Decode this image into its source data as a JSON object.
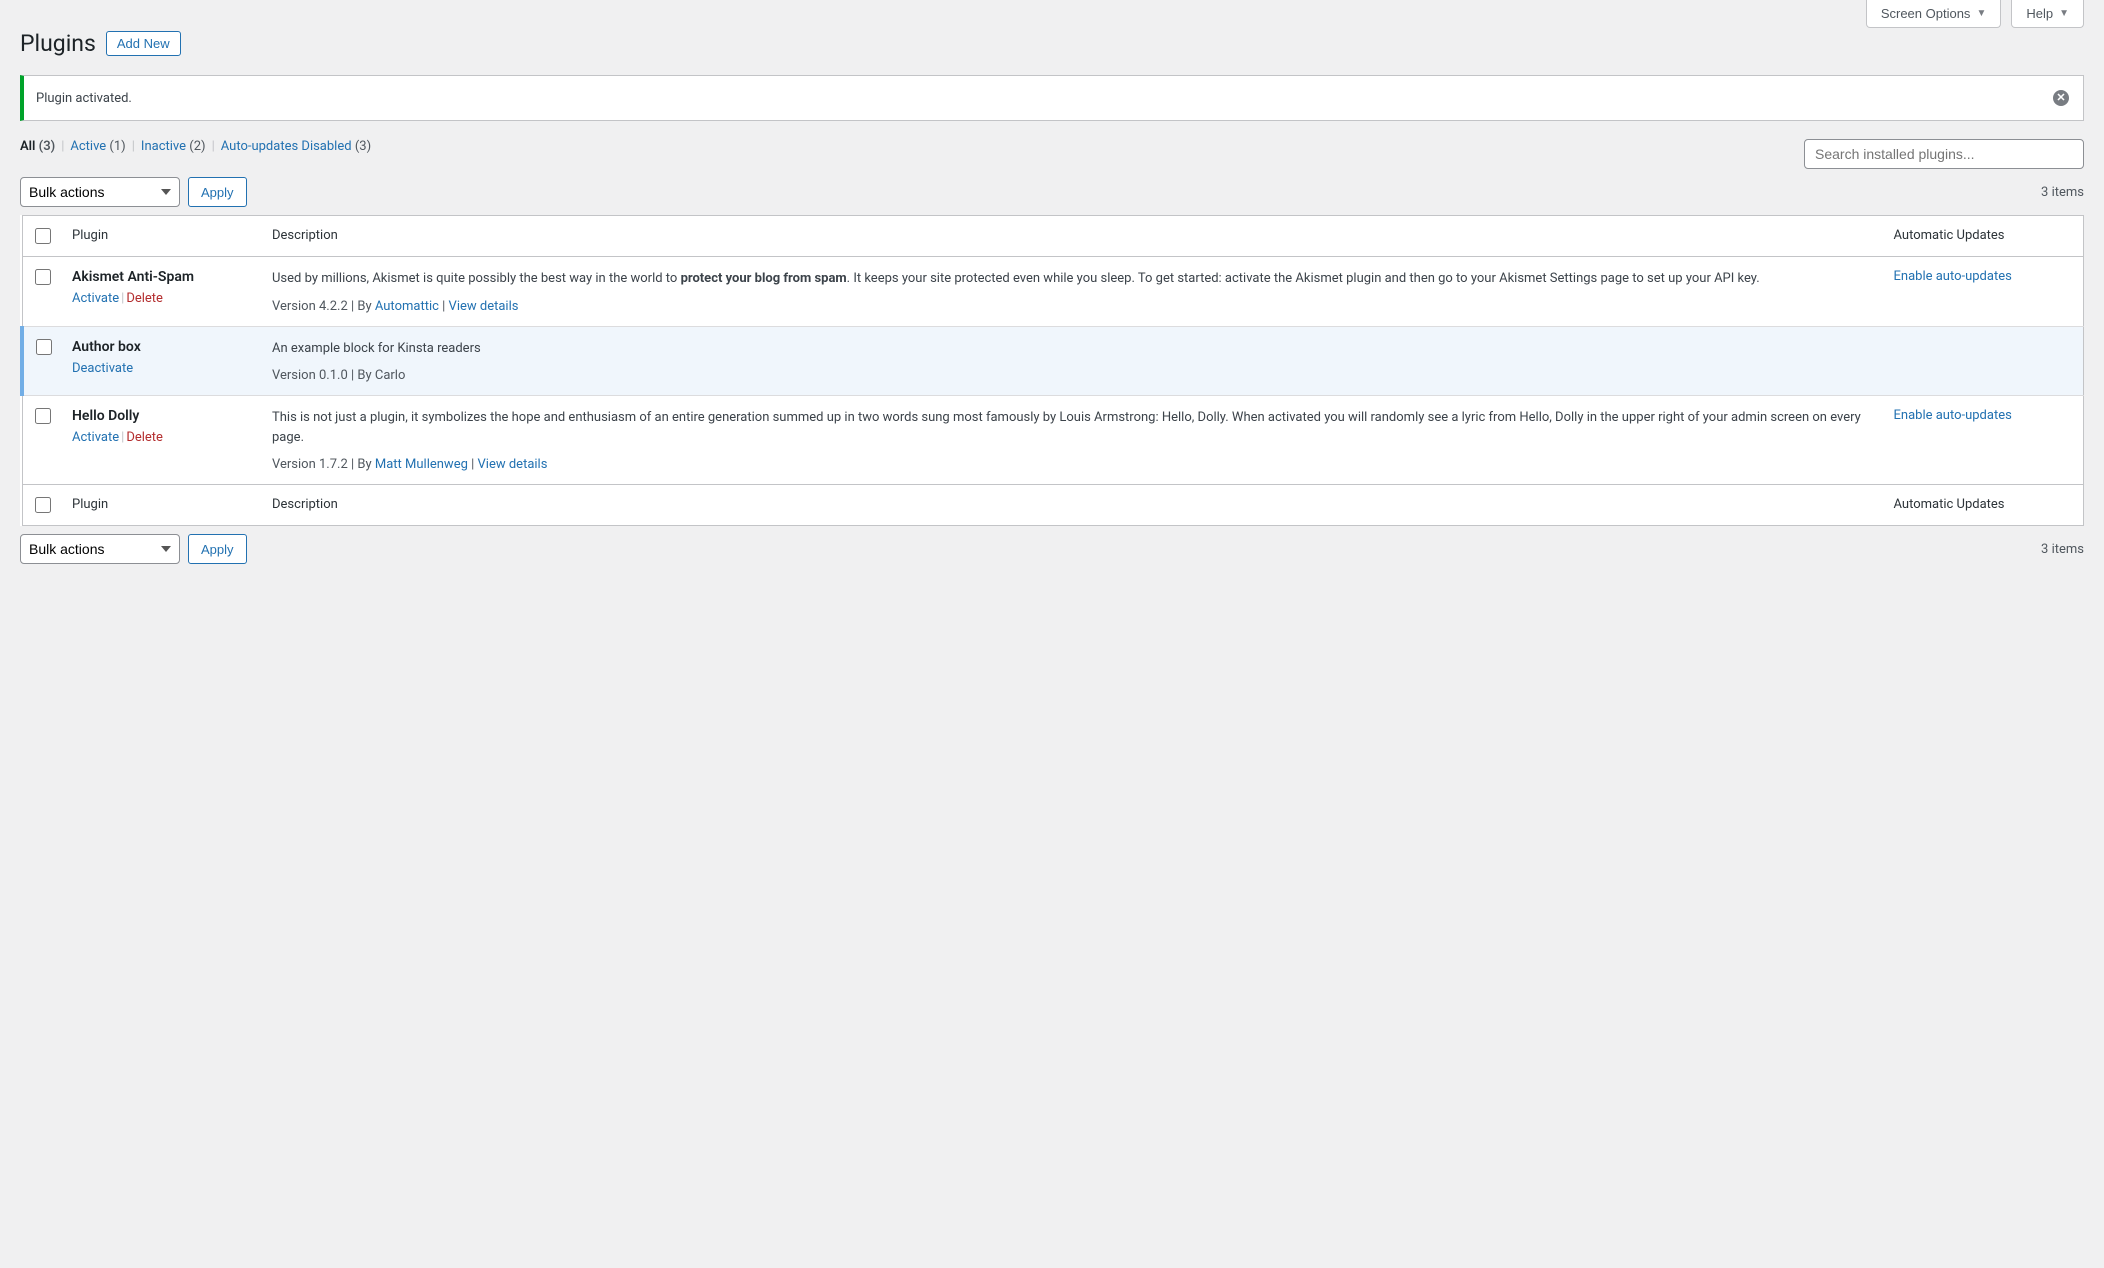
{
  "top_tabs": {
    "screen_options": "Screen Options",
    "help": "Help"
  },
  "page_title": "Plugins",
  "add_new_label": "Add New",
  "notice": {
    "message": "Plugin activated."
  },
  "filters": {
    "all": {
      "label": "All",
      "count": "(3)"
    },
    "active": {
      "label": "Active",
      "count": "(1)"
    },
    "inactive": {
      "label": "Inactive",
      "count": "(2)"
    },
    "auto_disabled": {
      "label": "Auto-updates Disabled",
      "count": "(3)"
    }
  },
  "search": {
    "placeholder": "Search installed plugins..."
  },
  "bulk": {
    "label": "Bulk actions",
    "apply": "Apply"
  },
  "items_count": "3 items",
  "columns": {
    "plugin": "Plugin",
    "description": "Description",
    "auto_updates": "Automatic Updates"
  },
  "actions": {
    "activate": "Activate",
    "deactivate": "Deactivate",
    "delete": "Delete",
    "enable_auto": "Enable auto-updates",
    "view_details": "View details"
  },
  "plugins": [
    {
      "name": "Akismet Anti-Spam",
      "active": false,
      "desc_pre": "Used by millions, Akismet is quite possibly the best way in the world to ",
      "desc_strong": "protect your blog from spam",
      "desc_post": ". It keeps your site protected even while you sleep. To get started: activate the Akismet plugin and then go to your Akismet Settings page to set up your API key.",
      "version": "Version 4.2.2",
      "by": "By ",
      "author": "Automattic",
      "has_details": true,
      "has_auto": true
    },
    {
      "name": "Author box",
      "active": true,
      "desc_pre": "An example block for Kinsta readers",
      "desc_strong": "",
      "desc_post": "",
      "version": "Version 0.1.0",
      "by_full": "By Carlo",
      "has_details": false,
      "has_auto": false
    },
    {
      "name": "Hello Dolly",
      "active": false,
      "desc_pre": "This is not just a plugin, it symbolizes the hope and enthusiasm of an entire generation summed up in two words sung most famously by Louis Armstrong: Hello, Dolly. When activated you will randomly see a lyric from Hello, Dolly in the upper right of your admin screen on every page.",
      "desc_strong": "",
      "desc_post": "",
      "version": "Version 1.7.2",
      "by": "By ",
      "author": "Matt Mullenweg",
      "has_details": true,
      "has_auto": true
    }
  ]
}
